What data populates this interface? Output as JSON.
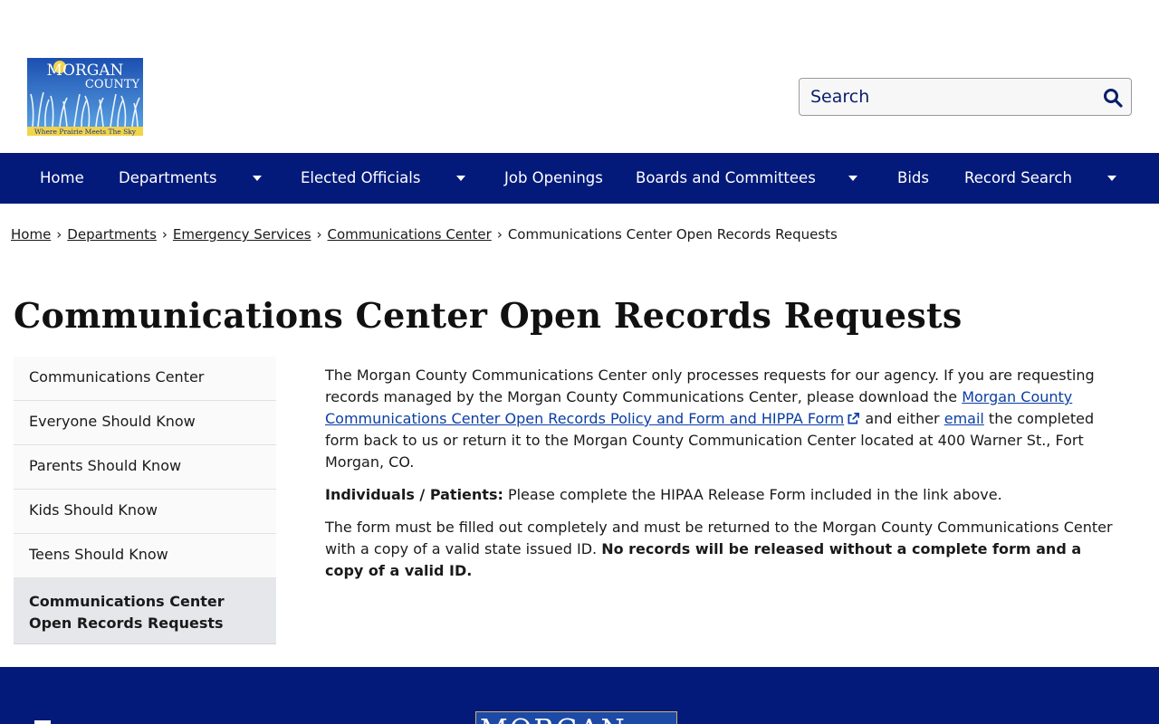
{
  "logo": {
    "line1": "MORGAN",
    "line2": "COUNTY",
    "tagline": "Where Prairie Meets The Sky"
  },
  "search": {
    "placeholder": "Search",
    "icon": "search-icon"
  },
  "nav": {
    "items": [
      {
        "label": "Home"
      },
      {
        "label": "Departments",
        "has_dropdown": true
      },
      {
        "label": "Elected Officials",
        "has_dropdown": true
      },
      {
        "label": "Job Openings"
      },
      {
        "label": "Boards and Committees",
        "has_dropdown": true
      },
      {
        "label": "Bids"
      },
      {
        "label": "Record Search",
        "has_dropdown": true
      }
    ]
  },
  "breadcrumb": {
    "separator": "›",
    "items": [
      "Home",
      "Departments",
      "Emergency Services",
      "Communications Center"
    ],
    "current": "Communications Center Open Records Requests"
  },
  "page": {
    "title": "Communications Center Open Records Requests"
  },
  "sidebar": {
    "items": [
      {
        "label": "Communications Center"
      },
      {
        "label": "Everyone Should Know"
      },
      {
        "label": "Parents Should Know"
      },
      {
        "label": "Kids Should Know"
      },
      {
        "label": "Teens Should Know"
      },
      {
        "label": "Communications Center Open Records Requests",
        "active": true
      }
    ]
  },
  "content": {
    "p1_a": "The Morgan County Communications Center only processes requests for our agency. If you are requesting records managed by the Morgan County Communications Center, please download the ",
    "p1_link": "Morgan County Communications Center Open Records Policy and Form and HIPPA Form",
    "p1_b": " and either ",
    "p1_email": "email",
    "p1_c": " the completed form back to us or return it to the Morgan County Communication Center located at 400 Warner St., Fort Morgan, CO.",
    "p2_bold": "Individuals / Patients:",
    "p2_text": " Please complete the HIPAA Release Form included in the link above.",
    "p3_text": "The form must be filled out completely and must be returned to the Morgan County Communications Center with a copy of a valid state issued ID. ",
    "p3_bold": "No records will be released without a complete form and a copy of a valid ID."
  },
  "footer": {
    "logo_text": "MORGAN"
  },
  "colors": {
    "nav_bg": "#031a7a",
    "link": "#0a3ea6",
    "sidebar_active_bg": "#e5e7eb"
  }
}
